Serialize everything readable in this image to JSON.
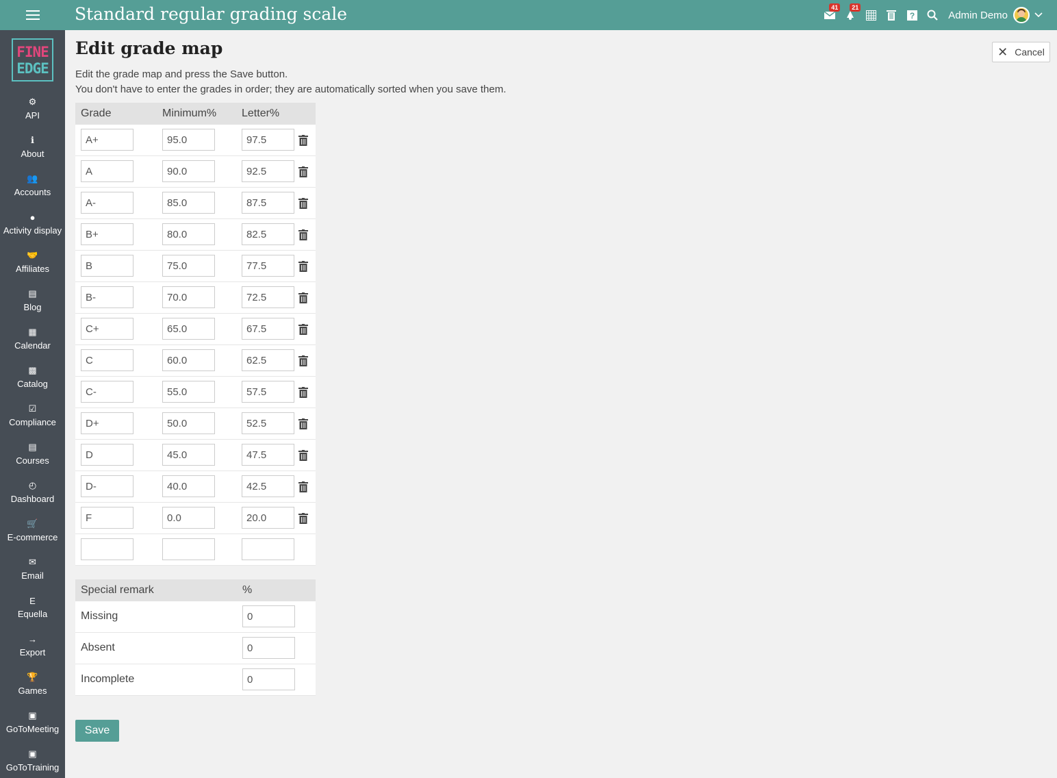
{
  "header": {
    "title": "Standard regular grading scale",
    "user_name": "Admin Demo",
    "icons": [
      {
        "name": "messages-icon",
        "badge": "41"
      },
      {
        "name": "notifications-icon",
        "badge": "21"
      },
      {
        "name": "calendar-icon",
        "badge": ""
      },
      {
        "name": "trash-icon",
        "badge": ""
      },
      {
        "name": "help-icon",
        "badge": ""
      },
      {
        "name": "search-icon",
        "badge": ""
      }
    ]
  },
  "logo": {
    "line1": "FINE",
    "line2": "EDGE"
  },
  "sidebar": {
    "items": [
      {
        "label": "API",
        "icon": "⚙"
      },
      {
        "label": "About",
        "icon": "ℹ"
      },
      {
        "label": "Accounts",
        "icon": "👥"
      },
      {
        "label": "Activity display",
        "icon": "●"
      },
      {
        "label": "Affiliates",
        "icon": "🤝"
      },
      {
        "label": "Blog",
        "icon": "▤"
      },
      {
        "label": "Calendar",
        "icon": "▦"
      },
      {
        "label": "Catalog",
        "icon": "▩"
      },
      {
        "label": "Compliance",
        "icon": "☑"
      },
      {
        "label": "Courses",
        "icon": "▤"
      },
      {
        "label": "Dashboard",
        "icon": "◴"
      },
      {
        "label": "E-commerce",
        "icon": "🛒"
      },
      {
        "label": "Email",
        "icon": "✉"
      },
      {
        "label": "Equella",
        "icon": "E"
      },
      {
        "label": "Export",
        "icon": "→"
      },
      {
        "label": "Games",
        "icon": "🏆"
      },
      {
        "label": "GoToMeeting",
        "icon": "▣"
      },
      {
        "label": "GoToTraining",
        "icon": "▣"
      }
    ]
  },
  "main": {
    "title": "Edit grade map",
    "desc_line1": "Edit the grade map and press the Save button.",
    "desc_line2": "You don't have to enter the grades in order; they are automatically sorted when you save them.",
    "cancel_label": "Cancel",
    "save_label": "Save"
  },
  "grade_table": {
    "headers": {
      "grade": "Grade",
      "minimum": "Minimum%",
      "letter": "Letter%"
    },
    "rows": [
      {
        "grade": "A+",
        "minimum": "95.0",
        "letter": "97.5"
      },
      {
        "grade": "A",
        "minimum": "90.0",
        "letter": "92.5"
      },
      {
        "grade": "A-",
        "minimum": "85.0",
        "letter": "87.5"
      },
      {
        "grade": "B+",
        "minimum": "80.0",
        "letter": "82.5"
      },
      {
        "grade": "B",
        "minimum": "75.0",
        "letter": "77.5"
      },
      {
        "grade": "B-",
        "minimum": "70.0",
        "letter": "72.5"
      },
      {
        "grade": "C+",
        "minimum": "65.0",
        "letter": "67.5"
      },
      {
        "grade": "C",
        "minimum": "60.0",
        "letter": "62.5"
      },
      {
        "grade": "C-",
        "minimum": "55.0",
        "letter": "57.5"
      },
      {
        "grade": "D+",
        "minimum": "50.0",
        "letter": "52.5"
      },
      {
        "grade": "D",
        "minimum": "45.0",
        "letter": "47.5"
      },
      {
        "grade": "D-",
        "minimum": "40.0",
        "letter": "42.5"
      },
      {
        "grade": "F",
        "minimum": "0.0",
        "letter": "20.0"
      }
    ],
    "empty_row": {
      "grade": "",
      "minimum": "",
      "letter": ""
    }
  },
  "remark_table": {
    "headers": {
      "remark": "Special remark",
      "percent": "%"
    },
    "rows": [
      {
        "label": "Missing",
        "value": "0"
      },
      {
        "label": "Absent",
        "value": "0"
      },
      {
        "label": "Incomplete",
        "value": "0"
      }
    ]
  },
  "colors": {
    "primary": "#559e96",
    "sidebar": "#464d55",
    "badge": "#d9342b"
  }
}
